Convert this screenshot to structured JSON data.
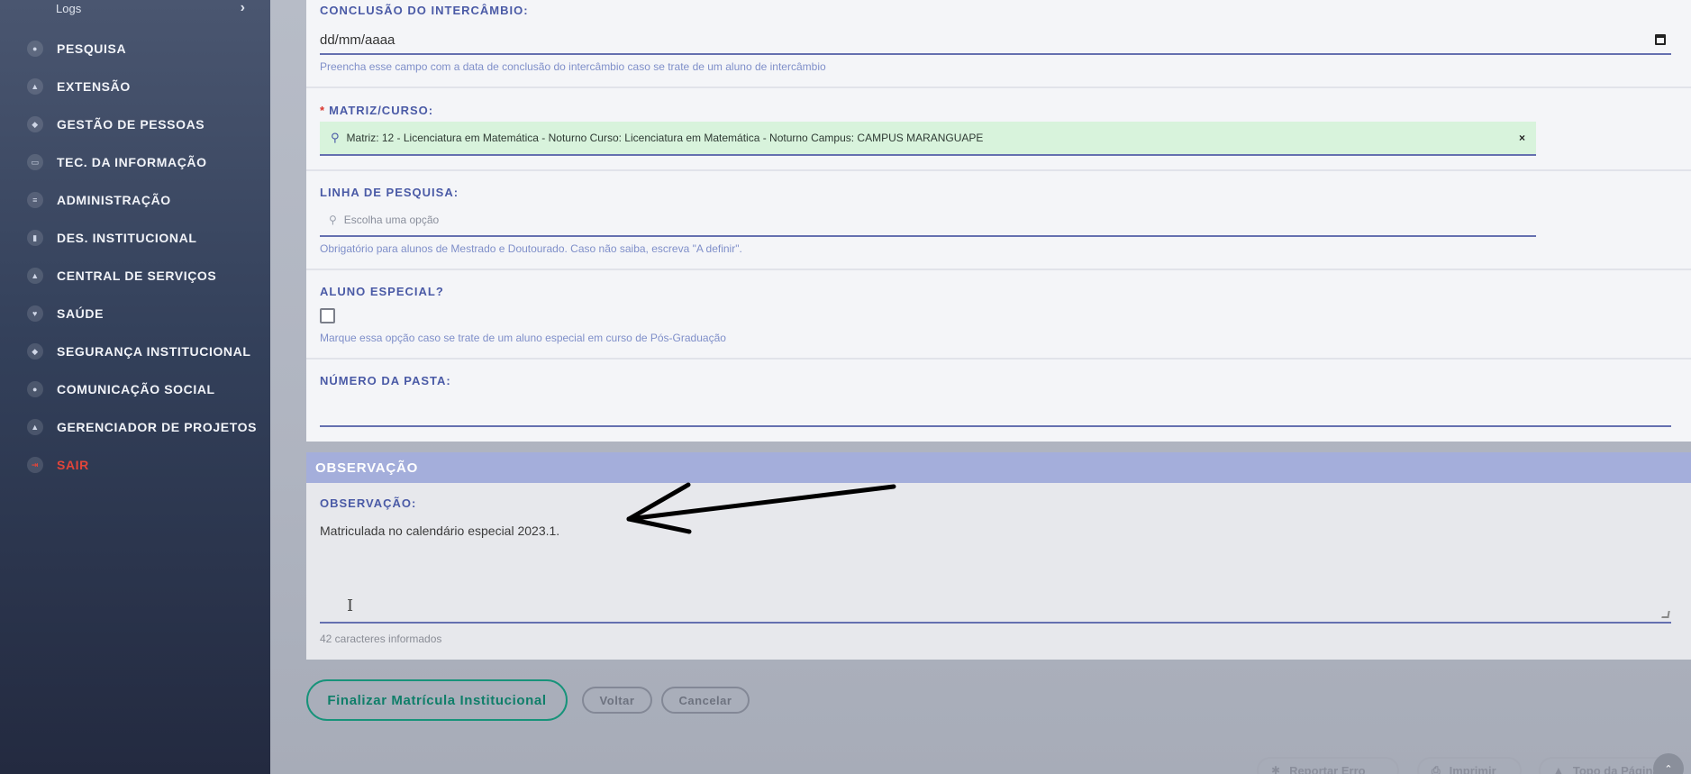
{
  "sidebar": {
    "logs_label": "Logs",
    "logs_chevron": "›",
    "items": [
      {
        "label": "PESQUISA",
        "icon": "●"
      },
      {
        "label": "EXTENSÃO",
        "icon": "▲"
      },
      {
        "label": "GESTÃO DE PESSOAS",
        "icon": "◆"
      },
      {
        "label": "TEC. DA INFORMAÇÃO",
        "icon": "▭"
      },
      {
        "label": "ADMINISTRAÇÃO",
        "icon": "≡"
      },
      {
        "label": "DES. INSTITUCIONAL",
        "icon": "▮"
      },
      {
        "label": "CENTRAL DE SERVIÇOS",
        "icon": "▲"
      },
      {
        "label": "SAÚDE",
        "icon": "♥"
      },
      {
        "label": "SEGURANÇA INSTITUCIONAL",
        "icon": "◆"
      },
      {
        "label": "COMUNICAÇÃO SOCIAL",
        "icon": "●"
      },
      {
        "label": "GERENCIADOR DE PROJETOS",
        "icon": "▲"
      },
      {
        "label": "SAIR",
        "icon": "⇥"
      }
    ]
  },
  "form": {
    "conclusao": {
      "label": "CONCLUSÃO DO INTERCÂMBIO:",
      "value": "dd/mm/aaaa",
      "help": "Preencha esse campo com a data de conclusão do intercâmbio caso se trate de um aluno de intercâmbio"
    },
    "matriz": {
      "required_mark": "*",
      "label": "MATRIZ/CURSO:",
      "value": "Matriz: 12 - Licenciatura em Matemática - Noturno Curso: Licenciatura em Matemática - Noturno Campus: CAMPUS MARANGUAPE",
      "clear": "×",
      "search_icon": "🔍"
    },
    "linha": {
      "label": "LINHA DE PESQUISA:",
      "placeholder": "Escolha uma opção",
      "help": "Obrigatório para alunos de Mestrado e Doutourado. Caso não saiba, escreva \"A definir\".",
      "search_icon": "🔍"
    },
    "aluno_especial": {
      "label": "ALUNO ESPECIAL?",
      "checked": false,
      "help": "Marque essa opção caso se trate de um aluno especial em curso de Pós-Graduação"
    },
    "numero_pasta": {
      "label": "NÚMERO DA PASTA:",
      "value": ""
    }
  },
  "observacao": {
    "section_title": "OBSERVAÇÃO",
    "label": "OBSERVAÇÃO:",
    "value": "Matriculada no calendário especial 2023.1.",
    "char_count": "42 caracteres informados",
    "cursor_glyph": "I"
  },
  "actions": {
    "finalizar": "Finalizar Matrícula Institucional",
    "voltar": "Voltar",
    "cancelar": "Cancelar"
  },
  "footer": {
    "reportar": "Reportar Erro",
    "imprimir": "Imprimir",
    "topo": "Topo da Página",
    "reportar_icon": "✱",
    "imprimir_icon": "⎙",
    "topo_icon": "▲",
    "round_icon": "⌃"
  }
}
